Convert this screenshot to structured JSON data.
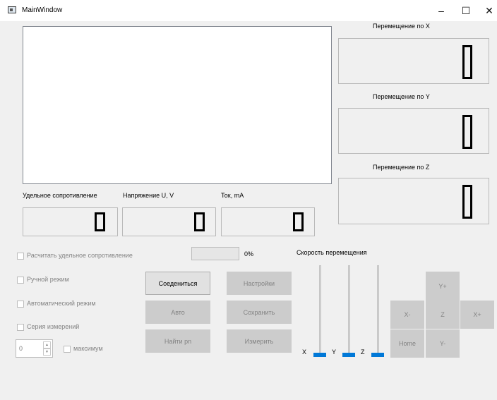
{
  "window": {
    "title": "MainWindow",
    "minimize": "–",
    "maximize": "☐",
    "close": "✕"
  },
  "icons": {
    "app": "app-window-icon",
    "spin_up": "▲",
    "spin_down": "▼"
  },
  "displacement": {
    "x": {
      "label": "Перемещение по X",
      "value": 0
    },
    "y": {
      "label": "Перемещение по Y",
      "value": 0
    },
    "z": {
      "label": "Перемещение по Z",
      "value": 0
    }
  },
  "readouts": {
    "resistivity": {
      "label": "Удельное сопротивление",
      "value": 0
    },
    "voltage": {
      "label": "Напряжение U, V",
      "value": 0
    },
    "current": {
      "label": "Ток, mA",
      "value": 0
    }
  },
  "options": {
    "calc_resistivity": "Расчитать удельное сопротивление",
    "manual_mode": "Ручной режим",
    "auto_mode": "Автоматический режим",
    "series": "Серия измерений",
    "maximum": "максимум",
    "spin_value": "0"
  },
  "progress": {
    "value": 0,
    "text": "0%"
  },
  "buttons": {
    "connect": "Соедениться",
    "settings": "Настройки",
    "auto": "Авто",
    "save": "Сохранить",
    "find_rn": "Найти рn",
    "measure": "Измерить"
  },
  "speed": {
    "label": "Скорость перемещения",
    "sliders": [
      {
        "name": "X",
        "value": 0
      },
      {
        "name": "Y",
        "value": 0
      },
      {
        "name": "Z",
        "value": 0
      }
    ]
  },
  "jog": {
    "yplus": "Y+",
    "xminus": "X-",
    "z": "Z",
    "xplus": "X+",
    "home": "Home",
    "yminus": "Y-"
  }
}
